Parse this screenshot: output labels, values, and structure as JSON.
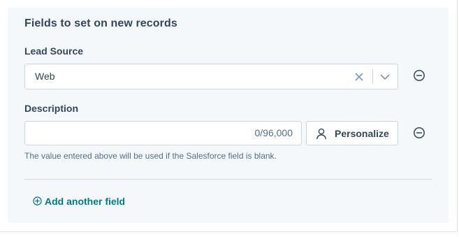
{
  "section": {
    "title": "Fields to set on new records"
  },
  "fields": [
    {
      "label": "Lead Source",
      "value": "Web",
      "clear_icon": "close-icon",
      "dropdown_icon": "chevron-down-icon",
      "remove_icon": "minus-circle-icon"
    },
    {
      "label": "Description",
      "value": "",
      "counter": "0/96,000",
      "personalize_label": "Personalize",
      "personalize_icon": "person-icon",
      "remove_icon": "minus-circle-icon",
      "help_text": "The value entered above will be used if the Salesforce field is blank."
    }
  ],
  "add_field": {
    "label": "Add another field",
    "icon": "plus-circle-icon"
  },
  "colors": {
    "card_background": "#f5f8fa",
    "text": "#33475b",
    "muted_text": "#516f90",
    "border": "#cbd6e2",
    "link": "#007a8c"
  }
}
